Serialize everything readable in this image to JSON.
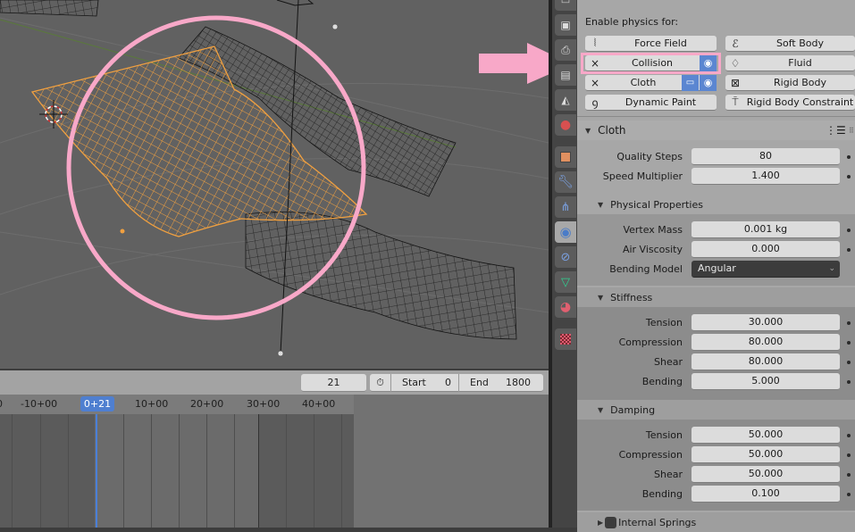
{
  "viewport": {
    "annotation_color": "#f8a8c8",
    "selected_mesh_color": "#f0a040",
    "wire_color": "#141414"
  },
  "timeline": {
    "current_frame": "21",
    "start_label": "Start",
    "start_value": "0",
    "end_label": "End",
    "end_value": "1800",
    "ruler": [
      "-10+00",
      "0+21",
      "10+00",
      "20+00",
      "30+00",
      "40+00"
    ],
    "playhead_label": "0+21"
  },
  "tabs": [
    {
      "name": "tool-tab",
      "icon": "tool-icon"
    },
    {
      "name": "render-tab",
      "icon": "camera-icon"
    },
    {
      "name": "output-tab",
      "icon": "printer-icon"
    },
    {
      "name": "view-layer-tab",
      "icon": "image-stack-icon"
    },
    {
      "name": "scene-tab",
      "icon": "scene-icon"
    },
    {
      "name": "world-tab",
      "icon": "world-icon"
    },
    {
      "name": "object-tab",
      "icon": "object-icon"
    },
    {
      "name": "modifier-tab",
      "icon": "wrench-icon"
    },
    {
      "name": "particles-tab",
      "icon": "particles-icon"
    },
    {
      "name": "physics-tab",
      "icon": "physics-icon",
      "active": true
    },
    {
      "name": "constraints-tab",
      "icon": "constraint-icon"
    },
    {
      "name": "data-tab",
      "icon": "mesh-data-icon"
    },
    {
      "name": "material-tab",
      "icon": "material-icon"
    },
    {
      "name": "texture-tab",
      "icon": "texture-icon"
    }
  ],
  "physics": {
    "enable_label": "Enable physics for:",
    "buttons": {
      "force_field": "Force Field",
      "soft_body": "Soft Body",
      "collision": "Collision",
      "fluid": "Fluid",
      "cloth": "Cloth",
      "rigid_body": "Rigid Body",
      "dynamic_paint": "Dynamic Paint",
      "rigid_body_constraint": "Rigid Body Constraint"
    },
    "remove_glyph": "×"
  },
  "cloth": {
    "title": "Cloth",
    "quality_steps": {
      "label": "Quality Steps",
      "value": "80"
    },
    "speed_multiplier": {
      "label": "Speed Multiplier",
      "value": "1.400"
    },
    "physical": {
      "title": "Physical Properties",
      "vertex_mass": {
        "label": "Vertex Mass",
        "value": "0.001 kg"
      },
      "air_viscosity": {
        "label": "Air Viscosity",
        "value": "0.000"
      },
      "bending_model": {
        "label": "Bending Model",
        "value": "Angular"
      }
    },
    "stiffness": {
      "title": "Stiffness",
      "tension": {
        "label": "Tension",
        "value": "30.000"
      },
      "compression": {
        "label": "Compression",
        "value": "80.000"
      },
      "shear": {
        "label": "Shear",
        "value": "80.000"
      },
      "bending": {
        "label": "Bending",
        "value": "5.000"
      }
    },
    "damping": {
      "title": "Damping",
      "tension": {
        "label": "Tension",
        "value": "50.000"
      },
      "compression": {
        "label": "Compression",
        "value": "50.000"
      },
      "shear": {
        "label": "Shear",
        "value": "50.000"
      },
      "bending": {
        "label": "Bending",
        "value": "0.100"
      }
    },
    "internal_springs": {
      "title": "Internal Springs",
      "enabled": false
    }
  }
}
